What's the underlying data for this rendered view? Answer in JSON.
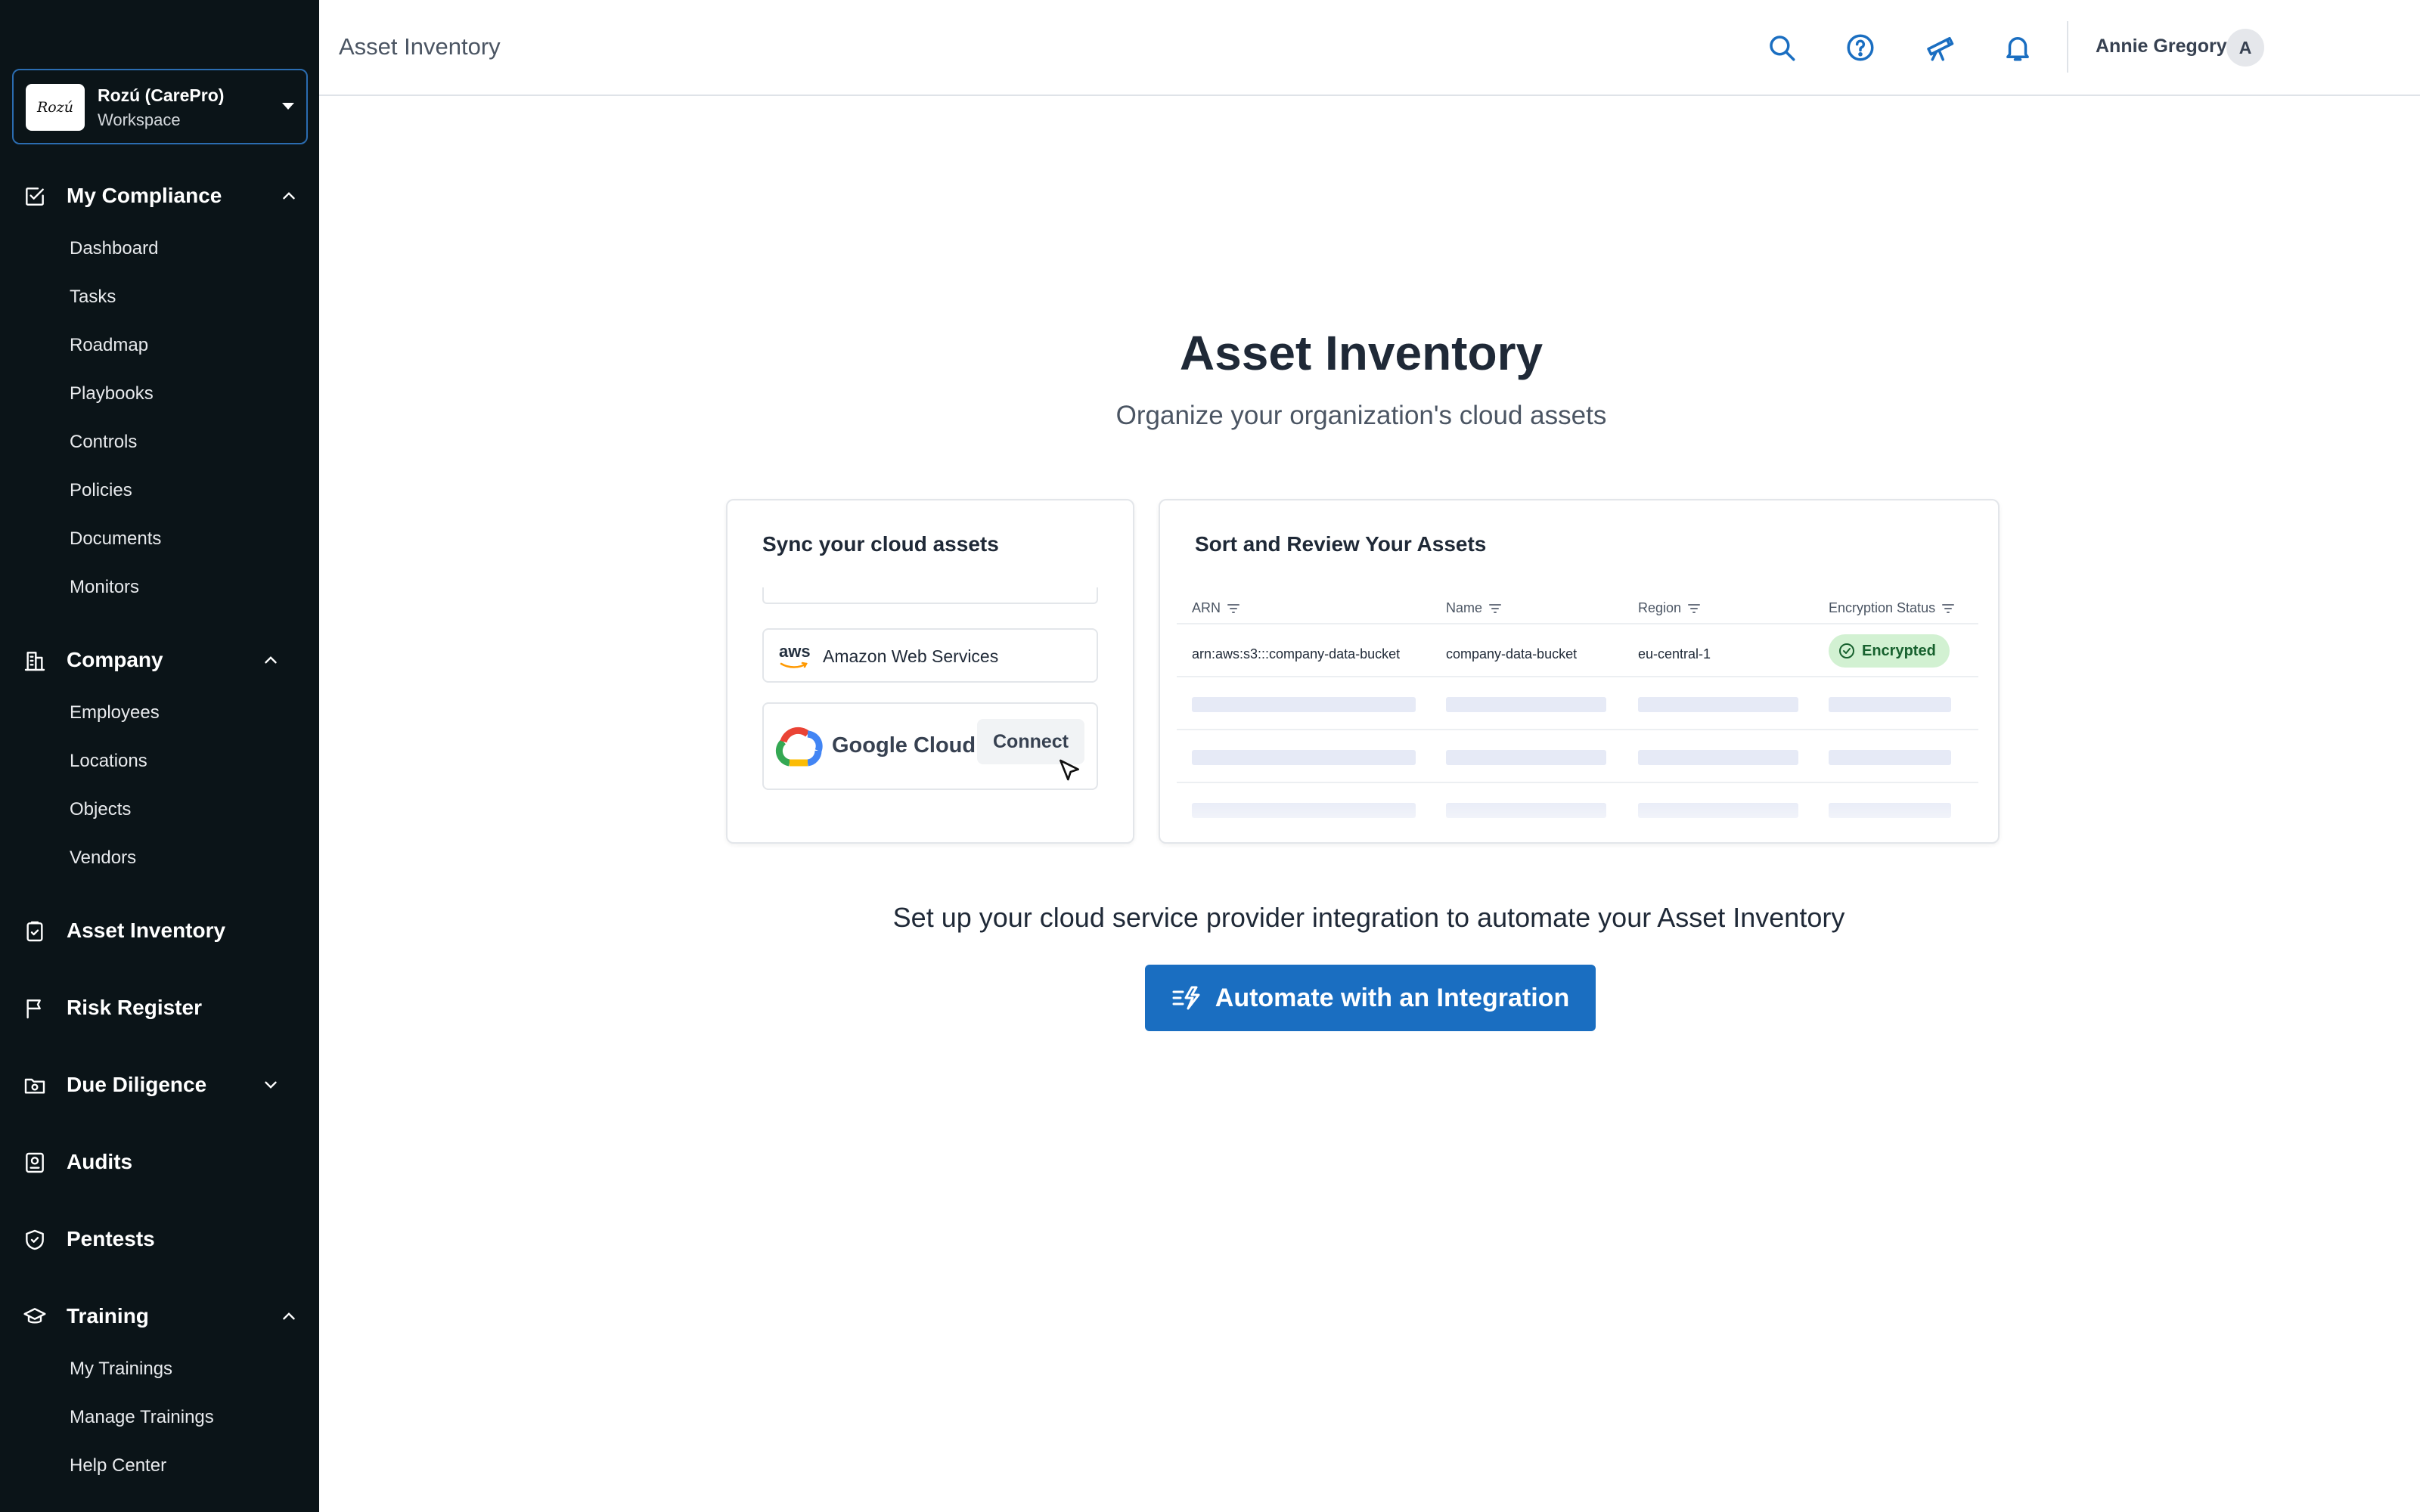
{
  "workspace": {
    "logo_text": "Rozú",
    "name": "Rozú (CarePro)",
    "subtitle": "Workspace"
  },
  "sidebar": {
    "sections": [
      {
        "label": "My Compliance",
        "icon": "checkbox-icon",
        "expanded": true,
        "items": [
          "Dashboard",
          "Tasks",
          "Roadmap",
          "Playbooks",
          "Controls",
          "Policies",
          "Documents",
          "Monitors"
        ]
      },
      {
        "label": "Company",
        "icon": "building-icon",
        "expanded": true,
        "items": [
          "Employees",
          "Locations",
          "Objects",
          "Vendors"
        ]
      },
      {
        "label": "Asset Inventory",
        "icon": "clipboard-icon"
      },
      {
        "label": "Risk Register",
        "icon": "flag-icon"
      },
      {
        "label": "Due Diligence",
        "icon": "folder-icon",
        "expanded": false
      },
      {
        "label": "Audits",
        "icon": "audit-icon"
      },
      {
        "label": "Pentests",
        "icon": "shield-icon"
      },
      {
        "label": "Training",
        "icon": "graduation-cap-icon",
        "expanded": true,
        "items": [
          "My Trainings",
          "Manage Trainings",
          "Help Center"
        ]
      }
    ]
  },
  "header": {
    "title": "Asset Inventory",
    "icons": [
      "search-icon",
      "help-icon",
      "telescope-icon",
      "bell-icon"
    ],
    "user_name": "Annie Gregory",
    "avatar_initial": "A"
  },
  "main": {
    "title": "Asset Inventory",
    "subtitle": "Organize your organization's cloud assets",
    "sync_card": {
      "title": "Sync your cloud assets",
      "providers": [
        {
          "logo_text": "aws",
          "name": "Amazon Web Services"
        },
        {
          "name": "Google Cloud",
          "action": "Connect"
        }
      ]
    },
    "review_card": {
      "title": "Sort and Review Your Assets",
      "columns": [
        "ARN",
        "Name",
        "Region",
        "Encryption Status"
      ],
      "rows": [
        {
          "arn": "arn:aws:s3:::company-data-bucket",
          "name": "company-data-bucket",
          "region": "eu-central-1",
          "status": "Encrypted"
        }
      ]
    },
    "cta_text": "Set up your cloud service provider integration to automate your Asset Inventory",
    "cta_button": "Automate with an Integration"
  },
  "colors": {
    "sidebar_bg": "#0b1418",
    "accent": "#1a6ec1",
    "encrypted_bg": "#d2f1d2",
    "encrypted_text": "#17612e"
  }
}
